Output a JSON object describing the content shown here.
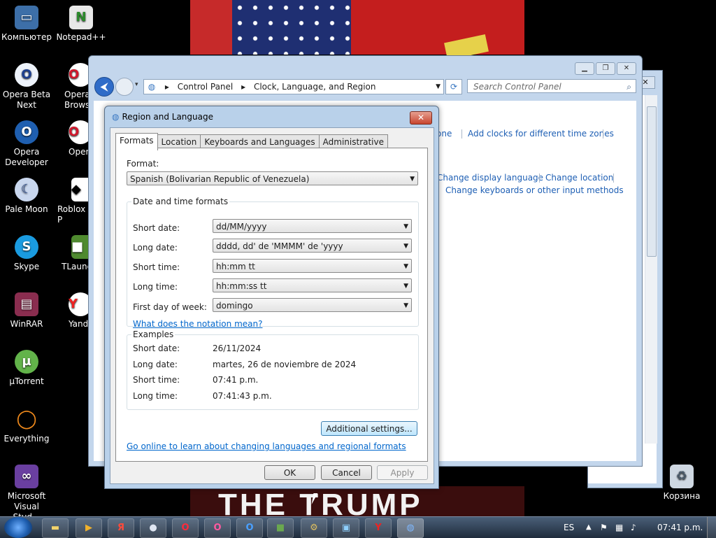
{
  "desktop": {
    "icons": [
      {
        "label": "Компьютер",
        "icon": "computer-icon"
      },
      {
        "label": "Notepad++",
        "icon": "notepadpp-icon"
      },
      {
        "label": "Opera Beta Next",
        "icon": "opera-beta-icon"
      },
      {
        "label": "Opera Brows",
        "icon": "opera-browser-icon"
      },
      {
        "label": "Opera Developer",
        "icon": "opera-developer-icon"
      },
      {
        "label": "Oper",
        "icon": "opera-icon"
      },
      {
        "label": "Pale Moon",
        "icon": "pale-moon-icon"
      },
      {
        "label": "Roblox P",
        "icon": "roblox-icon"
      },
      {
        "label": "Skype",
        "icon": "skype-icon"
      },
      {
        "label": "TLaunc",
        "icon": "tlauncher-icon"
      },
      {
        "label": "WinRAR",
        "icon": "winrar-icon"
      },
      {
        "label": "Yand",
        "icon": "yandex-icon"
      },
      {
        "label": "µTorrent",
        "icon": "utorrent-icon"
      },
      {
        "label": "Everything",
        "icon": "everything-icon"
      },
      {
        "label": "Microsoft Visual Stud...",
        "icon": "visual-studio-icon"
      },
      {
        "label": "Корзина",
        "icon": "recycle-bin-icon"
      }
    ],
    "wallpaper_text": "THE TRUMP"
  },
  "control_panel": {
    "address": {
      "root": "Control Panel",
      "current": "Clock, Language, and Region"
    },
    "search_placeholder": "Search Control Panel",
    "links": {
      "zone_partial": "one",
      "add_clocks": "Add clocks for different time zones",
      "change_display_language": "Change display language",
      "change_location": "Change location",
      "change_keyboards": "Change keyboards or other input methods"
    }
  },
  "dialog": {
    "title": "Region and Language",
    "close_glyph": "✕",
    "tabs": [
      "Formats",
      "Location",
      "Keyboards and Languages",
      "Administrative"
    ],
    "format_label": "Format:",
    "format_value": "Spanish (Bolivarian Republic of Venezuela)",
    "date_time_group": "Date and time formats",
    "rows": [
      {
        "label": "Short date:",
        "value": "dd/MM/yyyy"
      },
      {
        "label": "Long date:",
        "value": "dddd, dd' de 'MMMM' de 'yyyy"
      },
      {
        "label": "Short time:",
        "value": "hh:mm tt"
      },
      {
        "label": "Long time:",
        "value": "hh:mm:ss tt"
      },
      {
        "label": "First day of week:",
        "value": "domingo"
      }
    ],
    "notation_link": "What does the notation mean?",
    "examples_group": "Examples",
    "examples": [
      {
        "label": "Short date:",
        "value": "26/11/2024"
      },
      {
        "label": "Long date:",
        "value": "martes, 26 de noviembre de 2024"
      },
      {
        "label": "Short time:",
        "value": "07:41 p.m."
      },
      {
        "label": "Long time:",
        "value": "07:41:43 p.m."
      }
    ],
    "additional_settings": "Additional settings...",
    "online_link": "Go online to learn about changing languages and regional formats",
    "ok": "OK",
    "cancel": "Cancel",
    "apply": "Apply"
  },
  "taskbar": {
    "language": "ES",
    "clock": "07:41 p.m."
  },
  "colors": {
    "link": "#1e5fb4",
    "dialog_frame": "#b9d1ea",
    "taskbar": "#1f2c3c"
  }
}
